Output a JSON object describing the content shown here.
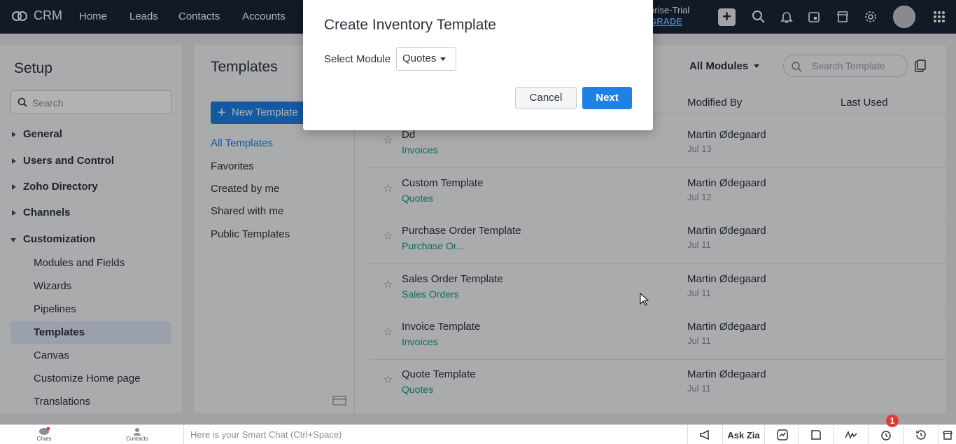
{
  "topnav": {
    "logo": "CRM",
    "items": [
      "Home",
      "Leads",
      "Contacts",
      "Accounts"
    ],
    "trial_label": "prise-Trial",
    "upgrade_label": "GRADE"
  },
  "setup": {
    "title": "Setup",
    "search_placeholder": "Search",
    "sections": [
      {
        "label": "General"
      },
      {
        "label": "Users and Control"
      },
      {
        "label": "Zoho Directory"
      },
      {
        "label": "Channels"
      },
      {
        "label": "Customization"
      }
    ],
    "sub_items": [
      "Modules and Fields",
      "Wizards",
      "Pipelines",
      "Templates",
      "Canvas",
      "Customize Home page",
      "Translations"
    ]
  },
  "main": {
    "title": "Templates",
    "new_button": "New Template",
    "filters": [
      "All Templates",
      "Favorites",
      "Created by me",
      "Shared with me",
      "Public Templates"
    ],
    "module_filter": "All Modules",
    "search_placeholder": "Search Template",
    "columns": {
      "modified_by": "Modified By",
      "last_used": "Last Used"
    },
    "rows": [
      {
        "name": "Dd",
        "module": "Invoices",
        "modified_by": "Martin Ødegaard",
        "date": "Jul 13"
      },
      {
        "name": "Custom Template",
        "module": "Quotes",
        "modified_by": "Martin Ødegaard",
        "date": "Jul 12"
      },
      {
        "name": "Purchase Order Template",
        "module": "Purchase Or...",
        "modified_by": "Martin Ødegaard",
        "date": "Jul 11"
      },
      {
        "name": "Sales Order Template",
        "module": "Sales Orders",
        "modified_by": "Martin Ødegaard",
        "date": "Jul 11"
      },
      {
        "name": "Invoice Template",
        "module": "Invoices",
        "modified_by": "Martin Ødegaard",
        "date": "Jul 11"
      },
      {
        "name": "Quote Template",
        "module": "Quotes",
        "modified_by": "Martin Ødegaard",
        "date": "Jul 11"
      }
    ]
  },
  "dialog": {
    "title": "Create Inventory Template",
    "select_label": "Select Module",
    "selected_module": "Quotes",
    "cancel": "Cancel",
    "next": "Next"
  },
  "bottombar": {
    "chats": "Chats",
    "contacts": "Contacts",
    "smart_chat_placeholder": "Here is your Smart Chat (Ctrl+Space)",
    "ask_zia": "Ask Zia",
    "notification_count": "1"
  }
}
